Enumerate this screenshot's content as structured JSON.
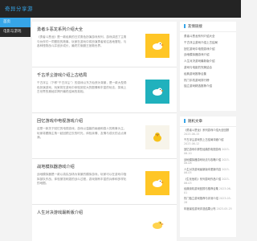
{
  "site": {
    "logo_text": "奇异分享游"
  },
  "nav": {
    "items": [
      {
        "label": "首页"
      },
      {
        "label": "电影与游戏"
      }
    ]
  },
  "posts": [
    {
      "title": "勇者斗恶龙系列介绍大全",
      "excerpt": "《勇者斗恶龙》是一款经典的日式角色扮演游戏系列，游戏讲述了主角与伙伴们一同冒险的故事。玩家在游戏中将扮演勇者前往各地冒险，与各种怪物战斗并逐步成长，最终打倒魔王拯救世界。",
      "thumb_icon": "duck-icon",
      "thumb_color": "yellow"
    },
    {
      "title": "千古浮尘游戏介绍上古结局",
      "excerpt": "千古浮尘（下称“千古浮尘”）的游戏以东方仙侠为背景，是一款大型角色扮演游戏，玩家将在游戏中体验到宏大的剧情和丰富的玩法，探索上古世界的奥秘并揭开最终结局的真相。",
      "thumb_icon": "duck-icon",
      "thumb_color": "teal"
    },
    {
      "title": "回忆游戏中电视游戏介绍",
      "excerpt": "这是一款关于回忆的电视游戏，游戏以温馨的画面和感人的故事为主，玩家将跟随主角一起回顾过去的时光，体验亲情、友情与成长的点点滴滴。",
      "thumb_icon": "chick-icon",
      "thumb_color": "cream"
    },
    {
      "title": "战地模拟器游戏介绍",
      "excerpt": "战地模拟器是一款以真实战场为背景的模拟游戏，玩家可以在游戏中指挥部队作战，体验紧张刺激的战斗过程，游戏拥有丰富的兵种和多样化的地图。",
      "thumb_icon": "duck-icon",
      "thumb_color": "yellow"
    },
    {
      "title": "人生对决游戏最新版介绍",
      "excerpt": "",
      "thumb_icon": "duck-icon",
      "thumb_color": "white"
    }
  ],
  "sidebar": {
    "friend_links": {
      "title": "友情链接",
      "items": [
        "勇者斗恶龙系列介绍大全",
        "千古浮尘游戏介绍上古结局",
        "回忆游戏中电视游戏介绍",
        "战地模拟器游戏介绍",
        "人生对决游戏最新版介绍",
        "游戏与电影的完美结合",
        "经典游戏推荐合集",
        "热门手机游戏排行榜",
        "独立游戏精选推荐介绍"
      ]
    },
    "recent": {
      "title": "随机文章",
      "items": [
        {
          "text": "《勇者斗恶龙》系列游戏介绍大全回顾",
          "date": "2023-06-15"
        },
        {
          "text": "千古浮尘游戏的上古结局详细介绍",
          "date": "2023-06-12"
        },
        {
          "text": "回忆游戏中那些经典的电视游戏",
          "date": "2023-06-10"
        },
        {
          "text": "战地模拟器游戏玩法与攻略介绍",
          "date": "2023-06-08"
        },
        {
          "text": "人生对决游戏最新版本更新内容",
          "date": "2023-06-05"
        },
        {
          "text": "《生化危机》系列游戏作品介绍",
          "date": "2023-06-03"
        },
        {
          "text": "经典街机游戏回顾与推荐合集",
          "date": "2023-06-01"
        },
        {
          "text": "热门独立游戏推荐与评测介绍",
          "date": "2023-05-28"
        },
        {
          "text": "年度最佳游戏评选结果公布",
          "date": "2023-05-25"
        }
      ]
    }
  }
}
